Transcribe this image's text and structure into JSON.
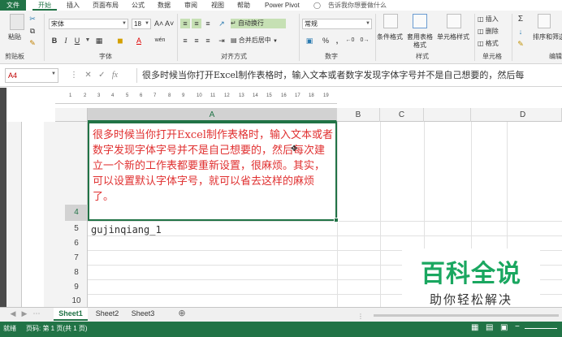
{
  "ribbon_tabs": [
    "文件",
    "开始",
    "插入",
    "页面布局",
    "公式",
    "数据",
    "审阅",
    "视图",
    "帮助",
    "Power Pivot",
    "告诉我你想要做什么"
  ],
  "clipboard": {
    "paste": "粘贴",
    "group": "剪贴板"
  },
  "font": {
    "name": "宋体",
    "size": "18",
    "bold": "B",
    "italic": "I",
    "underline": "U",
    "grow": "A˄",
    "shrink": "A˅",
    "font_color_label": "A",
    "wen": "wén",
    "group": "字体"
  },
  "alignment": {
    "wrap": "自动换行",
    "merge": "合并后居中",
    "group": "对齐方式"
  },
  "number": {
    "format": "常规",
    "percent": "%",
    "comma": ",",
    "group": "数字"
  },
  "styles": {
    "conditional": "条件格式",
    "table": "套用表格格式",
    "cell_styles": "单元格样式",
    "group": "样式"
  },
  "cells": {
    "insert": "插入",
    "delete": "删除",
    "format": "格式",
    "group": "单元格"
  },
  "editing": {
    "sort": "排序和筛选",
    "group": "编辑"
  },
  "formula_bar": {
    "name_box": "A4",
    "fx": "fx",
    "content": "很多时候当你打开Excel制作表格时，输入文本或者数字发现字体字号并不是自己想要的，然后每"
  },
  "ruler": {
    "ticks": [
      "1",
      "2",
      "3",
      "4",
      "5",
      "6",
      "7",
      "8",
      "9",
      "10",
      "11",
      "12",
      "13",
      "14",
      "15",
      "16",
      "17",
      "18",
      "19"
    ]
  },
  "columns": [
    "A",
    "B",
    "C",
    "D"
  ],
  "rows": [
    "4",
    "5",
    "6",
    "7",
    "8",
    "9",
    "10"
  ],
  "cells_data": {
    "A4": "很多时候当你打开Excel制作表格时，输入文本或者数字发现字体字号并不是自己想要的，然后每次建立一个新的工作表都要重新设置，很麻烦。其实，可以设置默认字体字号，就可以省去这样的麻烦了。",
    "A5": "gujinqiang_1"
  },
  "sheets": [
    "Sheet1",
    "Sheet2",
    "Sheet3"
  ],
  "status": {
    "ready": "就绪",
    "page": "页码: 第 1 页(共 1 页)"
  },
  "watermark": {
    "title": "百科全说",
    "subtitle": "助你轻松解决"
  },
  "colors": {
    "excel_green": "#217346",
    "cell_text": "#e03030",
    "watermark_green": "#1aa760"
  }
}
